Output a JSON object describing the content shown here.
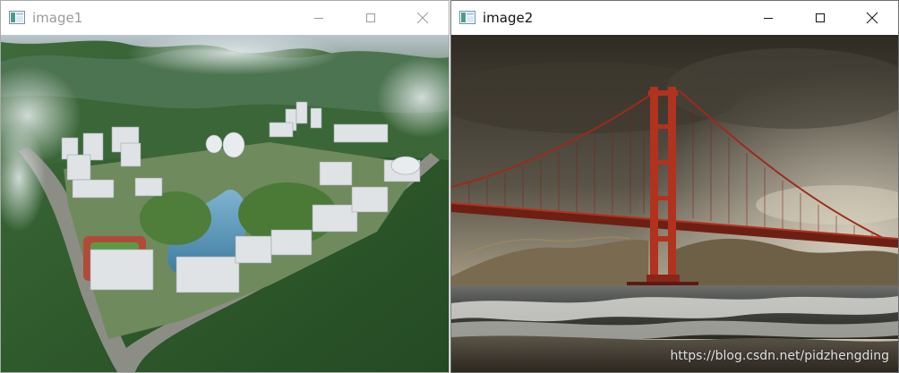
{
  "windows": [
    {
      "title": "image1",
      "active": false,
      "image_icon": "image-window-icon",
      "controls": [
        "minimize-icon",
        "maximize-icon",
        "close-icon"
      ]
    },
    {
      "title": "image2",
      "active": true,
      "image_icon": "image-window-icon",
      "controls": [
        "minimize-icon",
        "maximize-icon",
        "close-icon"
      ],
      "watermark": "https://blog.csdn.net/pidzhengding"
    }
  ],
  "colors": {
    "inactive_title": "#9a9a9a",
    "active_title": "#111111",
    "bridge_red": "#b2311f"
  }
}
